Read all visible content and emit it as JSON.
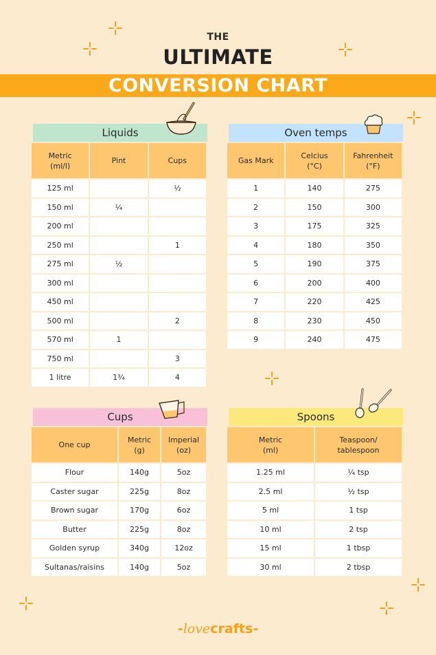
{
  "header": {
    "the": "THE",
    "ultimate": "ULTIMATE",
    "banner": "CONVERSION CHART"
  },
  "colors": {
    "background": "#fdebd0",
    "banner": "#fba91a",
    "header_cell": "#fdc66f",
    "liquids": "#bfe5cc",
    "oven": "#c3e2fb",
    "cups": "#f9c1d8",
    "spoons": "#fbe97b"
  },
  "liquids": {
    "title": "Liquids",
    "icon": "whisk-bowl-icon",
    "columns": [
      "Metric\n(ml/l)",
      "Pint",
      "Cups"
    ],
    "col_line1": [
      "Metric",
      "Pint",
      "Cups"
    ],
    "col_line2": [
      "(ml/l)",
      "",
      ""
    ],
    "rows": [
      [
        "125 ml",
        "",
        "½"
      ],
      [
        "150 ml",
        "¼",
        ""
      ],
      [
        "200 ml",
        "",
        ""
      ],
      [
        "250 ml",
        "",
        "1"
      ],
      [
        "275 ml",
        "½",
        ""
      ],
      [
        "300 ml",
        "",
        ""
      ],
      [
        "450 ml",
        "",
        ""
      ],
      [
        "500 ml",
        "",
        "2"
      ],
      [
        "570 ml",
        "1",
        ""
      ],
      [
        "750 ml",
        "",
        "3"
      ],
      [
        "1 litre",
        "1¾",
        "4"
      ]
    ]
  },
  "oven": {
    "title": "Oven temps",
    "icon": "cupcake-icon",
    "col_line1": [
      "Gas Mark",
      "Celcius",
      "Fahrenheit"
    ],
    "col_line2": [
      "",
      "(°C)",
      "(°F)"
    ],
    "rows": [
      [
        "1",
        "140",
        "275"
      ],
      [
        "2",
        "150",
        "300"
      ],
      [
        "3",
        "175",
        "325"
      ],
      [
        "4",
        "180",
        "350"
      ],
      [
        "5",
        "190",
        "375"
      ],
      [
        "6",
        "200",
        "400"
      ],
      [
        "7",
        "220",
        "425"
      ],
      [
        "8",
        "230",
        "450"
      ],
      [
        "9",
        "240",
        "475"
      ]
    ]
  },
  "cups": {
    "title": "Cups",
    "icon": "measuring-jug-icon",
    "col_line1": [
      "One cup",
      "Metric",
      "Imperial"
    ],
    "col_line2": [
      "",
      "(g)",
      "(oz)"
    ],
    "rows": [
      [
        "Flour",
        "140g",
        "5oz"
      ],
      [
        "Caster sugar",
        "225g",
        "8oz"
      ],
      [
        "Brown sugar",
        "170g",
        "6oz"
      ],
      [
        "Butter",
        "225g",
        "8oz"
      ],
      [
        "Golden syrup",
        "340g",
        "12oz"
      ],
      [
        "Sultanas/raisins",
        "140g",
        "5oz"
      ]
    ]
  },
  "spoons": {
    "title": "Spoons",
    "icon": "spoons-icon",
    "col_line1": [
      "Metric",
      "Teaspoon/"
    ],
    "col_line2": [
      "(ml)",
      "tablespoon"
    ],
    "rows": [
      [
        "1.25 ml",
        "¼ tsp"
      ],
      [
        "2.5 ml",
        "½ tsp"
      ],
      [
        "5 ml",
        "1 tsp"
      ],
      [
        "10 ml",
        "2 tsp"
      ],
      [
        "15 ml",
        "1 tbsp"
      ],
      [
        "30 ml",
        "2 tbsp"
      ]
    ]
  },
  "footer": {
    "logo_love": "love",
    "logo_crafts": "crafts",
    "logo_dash": "-"
  }
}
